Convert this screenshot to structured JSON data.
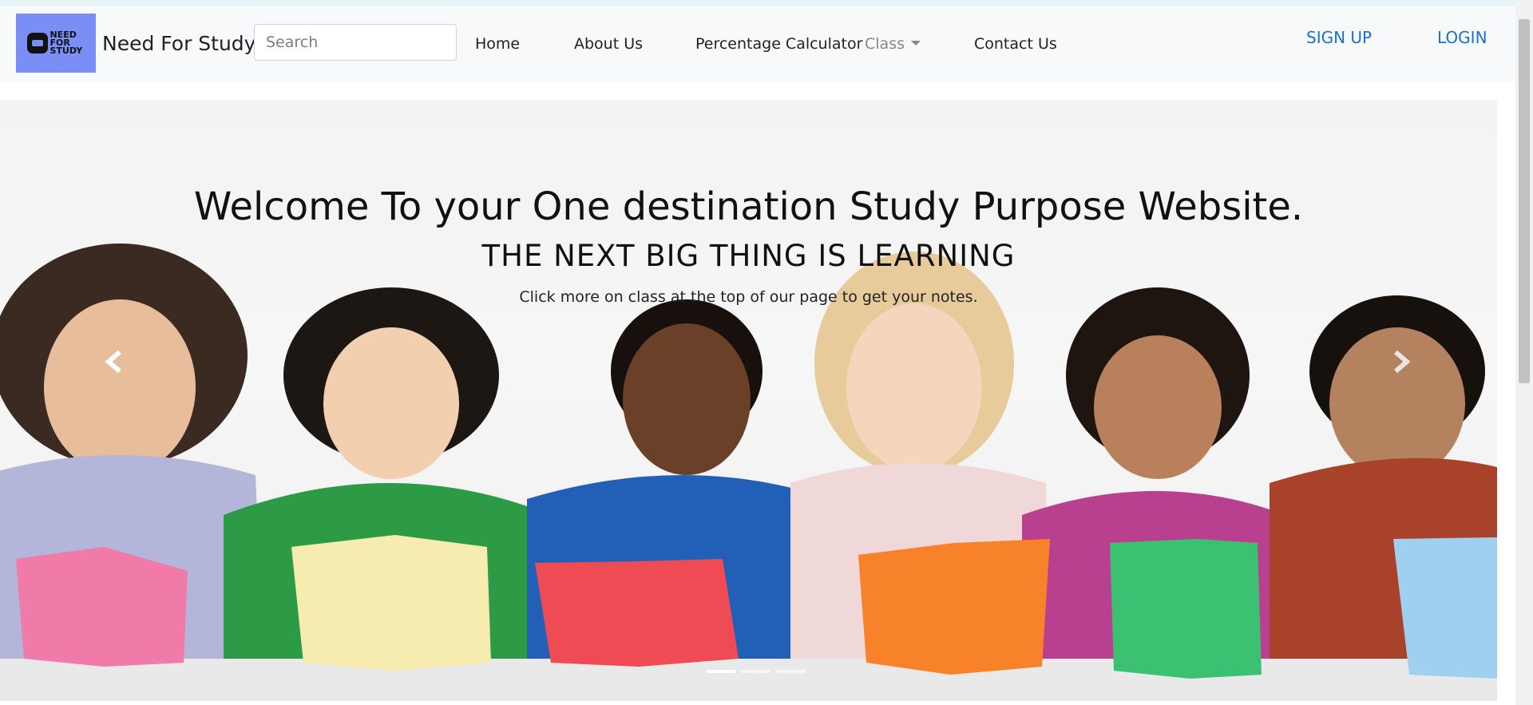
{
  "brand": {
    "logo_text": "NEED FOR STUDY",
    "name": "Need For Study"
  },
  "search": {
    "placeholder": "Search"
  },
  "nav": {
    "home": "Home",
    "about": "About Us",
    "percentage": "Percentage Calculator",
    "class": "Class",
    "contact": "Contact Us"
  },
  "auth": {
    "signup": "SIGN UP",
    "login": "LOGIN"
  },
  "carousel": {
    "heading": "Welcome To your One destination Study Purpose Website.",
    "subheading": "THE NEXT BIG THING IS LEARNING",
    "text": "Click more on class at the top of our page to get your notes.",
    "slide_count": 3,
    "active_slide": 1,
    "prev_icon": "chevron-left-icon",
    "next_icon": "chevron-right-icon"
  },
  "colors": {
    "logo_bg": "#7b8ef5",
    "link_accent": "#1a73c8",
    "navbar_bg": "#f8f9fa",
    "book_colors": [
      "#f07aa8",
      "#f7ecb0",
      "#ee4b55",
      "#f7822a",
      "#3cc173",
      "#9fd0ef"
    ],
    "shirt_colors": [
      "#b3b5d9",
      "#2d9b46",
      "#2260b8",
      "#f0d8d8",
      "#b8408e",
      "#a8422a"
    ]
  }
}
